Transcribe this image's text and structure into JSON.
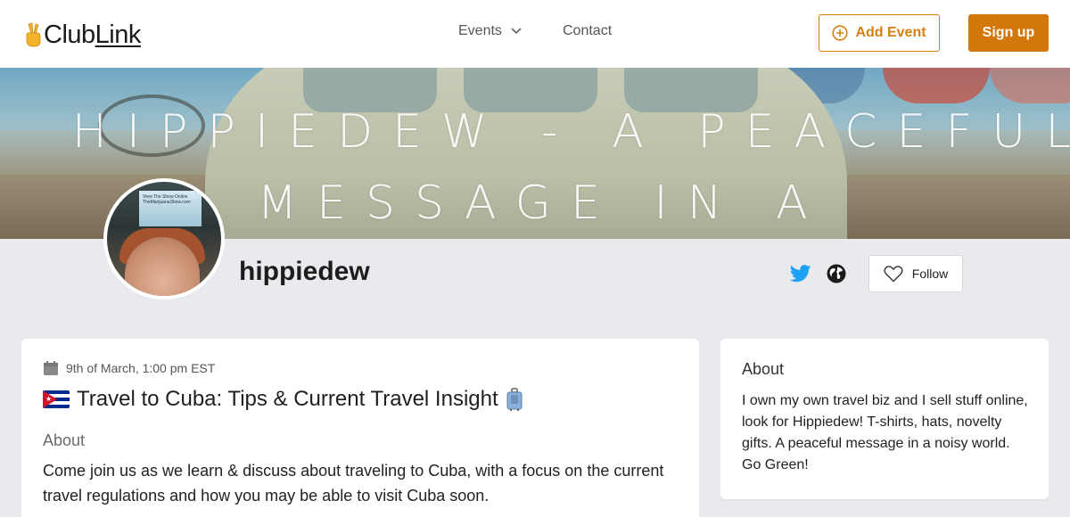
{
  "header": {
    "logo_prefix": "Club",
    "logo_suffix": "Link",
    "nav_events": "Events",
    "nav_contact": "Contact",
    "add_event": "Add Event",
    "sign_up": "Sign up"
  },
  "banner": {
    "line1": "HIPPIEDEW - A PEACEFUL",
    "line2": "MESSAGE IN A"
  },
  "profile": {
    "name": "hippiedew",
    "follow": "Follow",
    "avatar_screen_text": "View The Show Online TheMarijuanaShow.com"
  },
  "event": {
    "date": "9th of March, 1:00 pm EST",
    "title": "Travel to Cuba: Tips & Current Travel Insight",
    "about_heading": "About",
    "description": "Come join us as we learn & discuss about traveling to Cuba, with a focus on the current travel regulations and how you may be able to visit Cuba soon."
  },
  "about": {
    "heading": "About",
    "text": "I own my own travel biz and I sell stuff online, look for Hippiedew! T-shirts, hats, novelty gifts. A peaceful message in a noisy world. Go Green!"
  },
  "colors": {
    "accent": "#d4770b",
    "twitter": "#1da1f2",
    "background": "#e9eaee"
  },
  "icons": [
    "peace-hand-icon",
    "chevron-down-icon",
    "plus-circle-icon",
    "twitter-icon",
    "globe-icon",
    "heart-icon",
    "calendar-icon",
    "cuba-flag-icon",
    "luggage-icon"
  ]
}
